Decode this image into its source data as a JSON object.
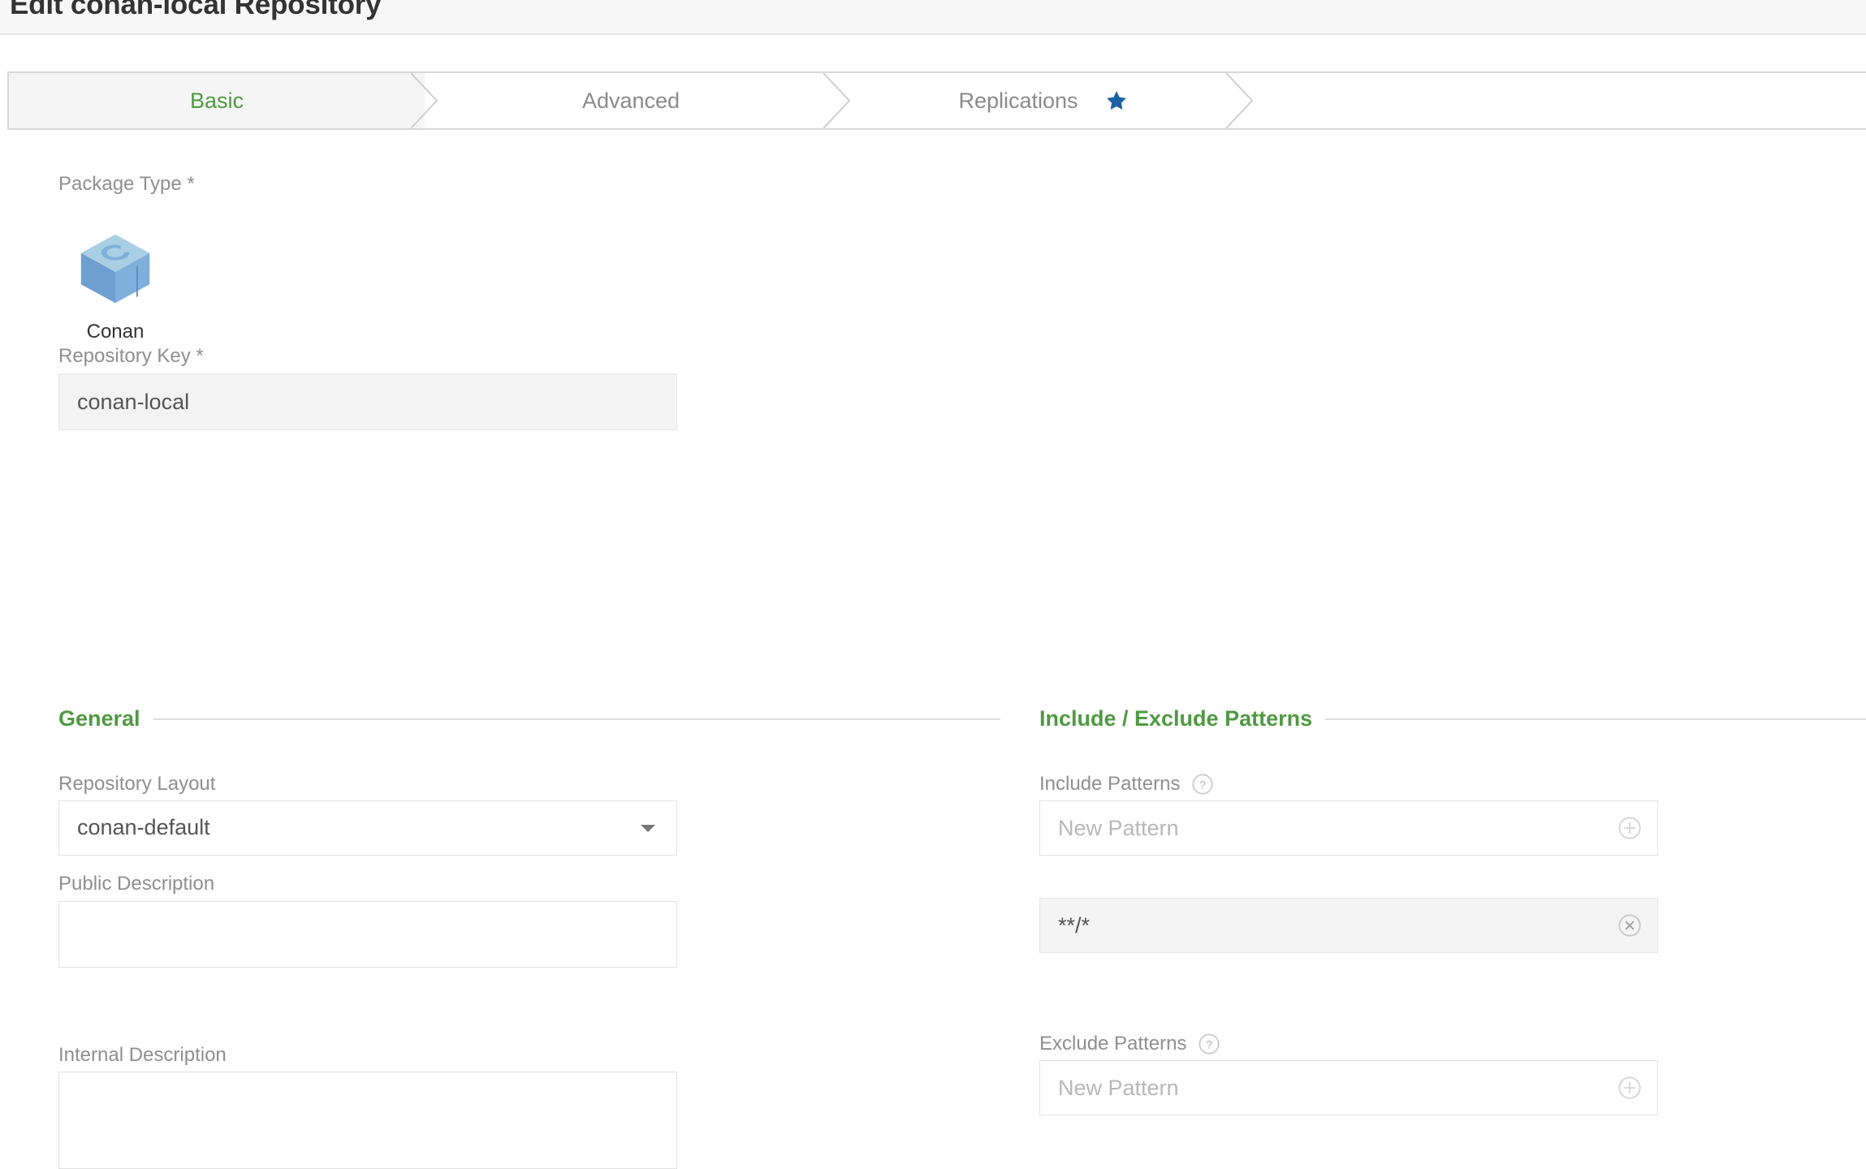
{
  "header": {
    "title": "Edit conan-local Repository"
  },
  "tabs": [
    {
      "label": "Basic",
      "active": true,
      "icon": null
    },
    {
      "label": "Advanced",
      "active": false,
      "icon": null
    },
    {
      "label": "Replications",
      "active": false,
      "icon": "star-icon"
    }
  ],
  "form": {
    "package_type": {
      "label": "Package Type *",
      "selected": {
        "name": "Conan",
        "icon": "conan-cube-icon"
      }
    },
    "repository_key": {
      "label": "Repository Key *",
      "value": "conan-local",
      "placeholder": ""
    },
    "general": {
      "section_title": "General",
      "repository_layout": {
        "label": "Repository Layout",
        "value": "conan-default",
        "caret_icon": "chevron-down-icon"
      },
      "public_description": {
        "label": "Public Description",
        "value": "",
        "placeholder": ""
      },
      "internal_description": {
        "label": "Internal Description",
        "value": "",
        "placeholder": ""
      }
    },
    "patterns": {
      "section_title": "Include / Exclude Patterns",
      "include": {
        "label": "Include Patterns",
        "help_icon": "help-circle-icon",
        "new_placeholder": "New Pattern",
        "add_icon": "plus-circle-icon",
        "items": [
          {
            "value": "**/*",
            "remove_icon": "remove-circle-icon"
          }
        ]
      },
      "exclude": {
        "label": "Exclude Patterns",
        "help_icon": "help-circle-icon",
        "new_placeholder": "New Pattern",
        "add_icon": "plus-circle-icon",
        "items": []
      }
    }
  },
  "colors": {
    "accent_green": "#4f9a41",
    "star_blue": "#1b62a5",
    "header_bg": "#f7f7f7",
    "active_tab_bg": "#f5f5f5",
    "border_gray": "#d8d8d8",
    "disabled_field_bg": "#f3f3f3"
  }
}
